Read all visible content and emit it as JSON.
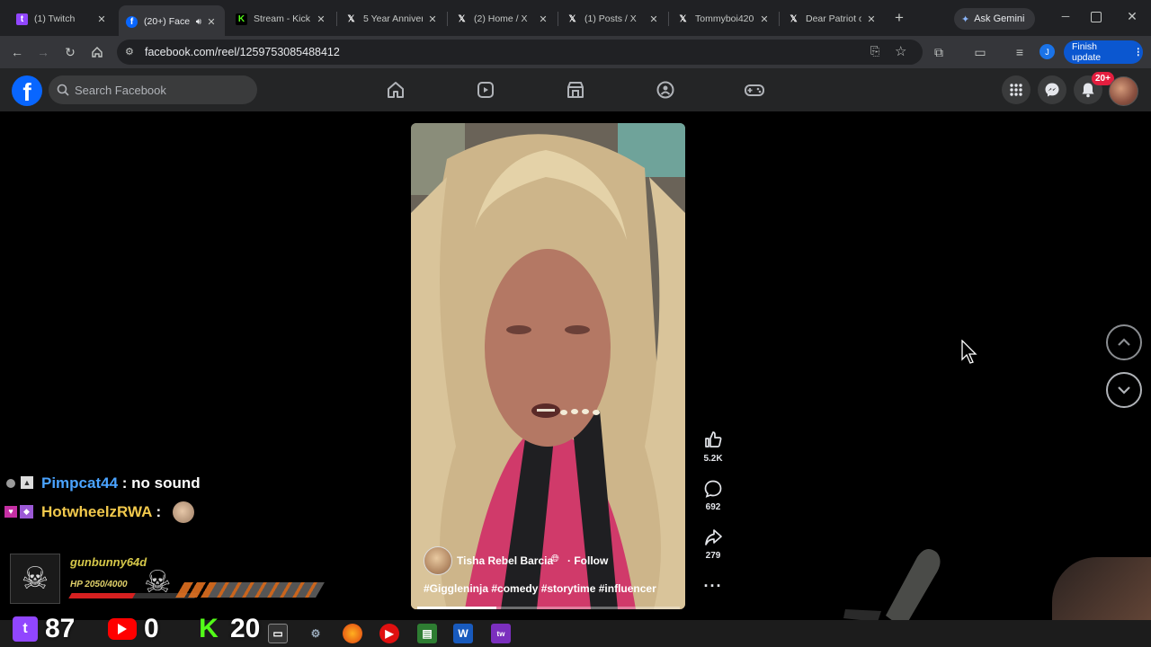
{
  "browser": {
    "tabs": [
      {
        "label": "(1) Twitch",
        "icon": "twitch-icon",
        "color": "#9146ff"
      },
      {
        "label": "(20+) Face",
        "icon": "facebook-icon",
        "color": "#0866ff",
        "active": true
      },
      {
        "label": "Stream - Kick",
        "icon": "kick-icon",
        "color": "#53fc18"
      },
      {
        "label": "5 Year Anniver",
        "icon": "x-icon",
        "color": "#ffffff"
      },
      {
        "label": "(2) Home / X",
        "icon": "x-icon",
        "color": "#ffffff"
      },
      {
        "label": "(1) Posts / X",
        "icon": "x-icon",
        "color": "#ffffff"
      },
      {
        "label": "Tommyboi420",
        "icon": "x-icon",
        "color": "#ffffff"
      },
      {
        "label": "Dear Patriot o",
        "icon": "x-icon",
        "color": "#ffffff"
      }
    ],
    "new_tab_symbol": "+",
    "gemini_label": "Ask Gemini",
    "url": "facebook.com/reel/1259753085488412",
    "profile_initial": "J",
    "finish_update_label": "Finish update"
  },
  "facebook": {
    "search_placeholder": "Search Facebook",
    "notification_badge": "20+",
    "brand_color": "#0866ff"
  },
  "reel": {
    "author": "Tisha Rebel Barcia",
    "follow_label": "· Follow",
    "hashtags": "#Giggleninja #comedy #storytime #influencer",
    "likes": "5.2K",
    "comments": "692",
    "shares": "279",
    "progress": 0.3
  },
  "chat_overlay": [
    {
      "user": "Pimpcat44",
      "user_color": "#4aa3ff",
      "message": ": no sound"
    },
    {
      "user": "HotwheelzRWA",
      "user_color": "#f2c94c",
      "message": ":"
    }
  ],
  "game_hud": {
    "player": "gunbunny64d",
    "hp": "HP 2050/4000",
    "hp_fraction": 0.51
  },
  "stream_stats": {
    "twitch_count": "87",
    "youtube_count": "0",
    "kick_count": "20"
  }
}
